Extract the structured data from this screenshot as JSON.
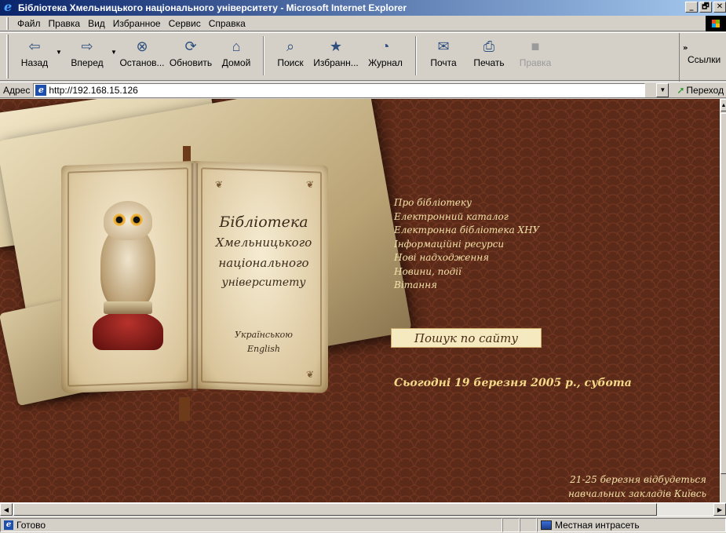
{
  "window": {
    "title": "Бібліотека Хмельницького національного університету - Microsoft Internet Explorer",
    "minimize": "_",
    "restore": "🗗",
    "close": "✕"
  },
  "menu": [
    "Файл",
    "Правка",
    "Вид",
    "Избранное",
    "Сервис",
    "Справка"
  ],
  "toolbar": {
    "back": "Назад",
    "forward": "Вперед",
    "stop": "Останов...",
    "refresh": "Обновить",
    "home": "Домой",
    "search": "Поиск",
    "favorites": "Избранн...",
    "history": "Журнал",
    "mail": "Почта",
    "print": "Печать",
    "edit": "Правка",
    "links": "Ссылки",
    "more": "»"
  },
  "address": {
    "label": "Адрес",
    "url": "http://192.168.15.126",
    "go": "Переход"
  },
  "page": {
    "book_title": [
      "Бібліотека",
      "Хмельницького",
      "національного",
      "університету"
    ],
    "book_lang": [
      "Українською",
      "English"
    ],
    "nav_links": [
      "Про бібліотеку",
      "Електронний каталог",
      "Електронна бібліотека ХНУ",
      "Інформаційні ресурси",
      "Нові надходження",
      "Новини, події",
      "Вітання"
    ],
    "search_button": "Пошук по сайту",
    "today": "Сьогодні 19 березня 2005 р., субота",
    "marquee": [
      "21-25 березня відбудеться",
      "навчальних закладів Київсь"
    ]
  },
  "status": {
    "text": "Готово",
    "zone": "Местная интрасеть"
  },
  "colors": {
    "background": "#5c2a18",
    "link_text": "#f3e2a9",
    "date_text": "#f3d98a",
    "search_bg": "#f5e9c0",
    "titlebar": "#0a246a"
  }
}
